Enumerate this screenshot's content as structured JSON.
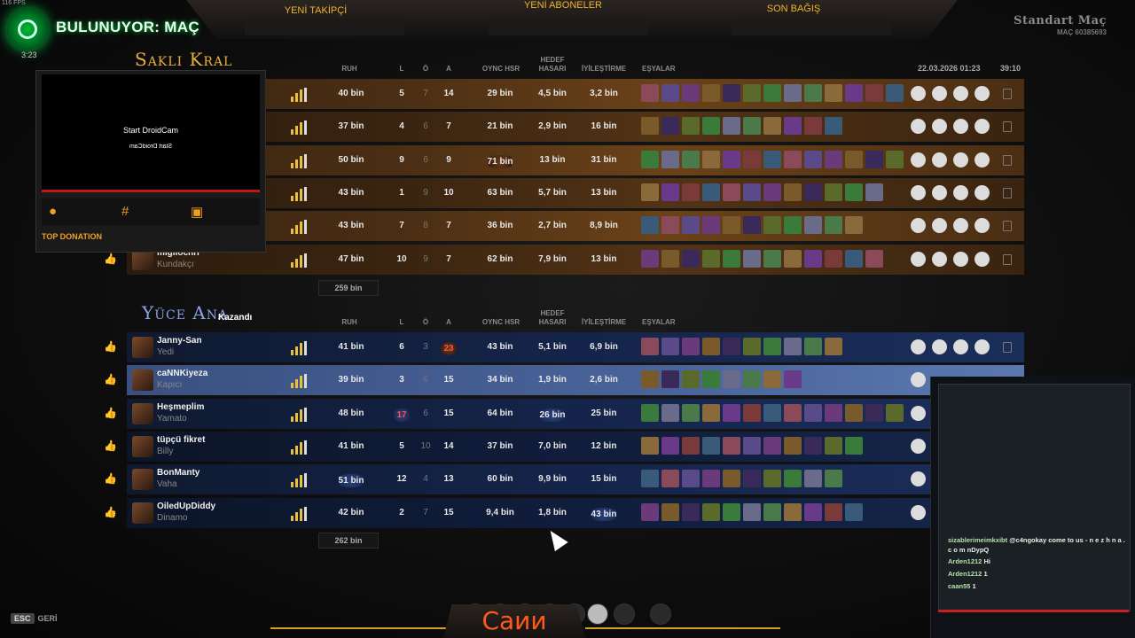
{
  "overlay": {
    "fps": "116 FPS",
    "status": "BULUNUYOR: MAÇ",
    "timer": "3:23",
    "new_follower": "YENİ TAKİPÇİ",
    "new_subscribers": "YENİ ABONELER",
    "last_donation": "SON BAĞIŞ",
    "mode": "Standart Maç",
    "match_id": "MAÇ 60385693",
    "webcam_text": "Start DroidCam",
    "top_donation": "TOP DONATION"
  },
  "headers": {
    "ruh": "RUH",
    "l": "L",
    "o": "Ö",
    "a": "A",
    "oync": "OYNC HSR",
    "hedef1": "HEDEF",
    "hedef2": "HASARI",
    "heal": "İYİLEŞTİRME",
    "items": "EŞYALAR",
    "date": "22.03.2026 01:23",
    "duration": "39:10"
  },
  "team1": {
    "name": "Saklı Kral",
    "total": "259 bin",
    "players": [
      {
        "name": "",
        "hero": "",
        "ruh": "40 bin",
        "l": "5",
        "o": "7",
        "a": "14",
        "dmg": "29 bin",
        "tower": "4,5 bin",
        "heal": "3,2 bin"
      },
      {
        "name": "",
        "hero": "",
        "ruh": "37 bin",
        "l": "4",
        "o": "6",
        "a": "7",
        "dmg": "21 bin",
        "tower": "2,9 bin",
        "heal": "16 bin"
      },
      {
        "name": "",
        "hero": "",
        "ruh": "50 bin",
        "l": "9",
        "o": "6",
        "a": "9",
        "dmg": "71 bin",
        "tower": "13 bin",
        "heal": "31 bin"
      },
      {
        "name": "",
        "hero": "",
        "ruh": "43 bin",
        "l": "1",
        "o": "9",
        "a": "10",
        "dmg": "63 bin",
        "tower": "5,7 bin",
        "heal": "13 bin"
      },
      {
        "name": "",
        "hero": "",
        "ruh": "43 bin",
        "l": "7",
        "o": "8",
        "a": "7",
        "dmg": "36 bin",
        "tower": "2,7 bin",
        "heal": "8,9 bin"
      },
      {
        "name": "migllochri",
        "hero": "Kundakçı",
        "ruh": "47 bin",
        "l": "10",
        "o": "9",
        "a": "7",
        "dmg": "62 bin",
        "tower": "7,9 bin",
        "heal": "13 bin"
      }
    ]
  },
  "team2": {
    "name": "Yüce Ana",
    "result": "Kazandı",
    "total": "262 bin",
    "players": [
      {
        "name": "Janny-San",
        "hero": "Yedi",
        "ruh": "41 bin",
        "l": "6",
        "o": "3",
        "a": "23",
        "dmg": "43 bin",
        "tower": "5,1 bin",
        "heal": "6,9 bin"
      },
      {
        "name": "caNNKiyeza",
        "hero": "Kapıcı",
        "ruh": "39 bin",
        "l": "3",
        "o": "6",
        "a": "15",
        "dmg": "34 bin",
        "tower": "1,9 bin",
        "heal": "2,6 bin"
      },
      {
        "name": "Heşmeplim",
        "hero": "Yamato",
        "ruh": "48 bin",
        "l": "17",
        "o": "6",
        "a": "15",
        "dmg": "64 bin",
        "tower": "26 bin",
        "heal": "25 bin"
      },
      {
        "name": "tüpçü fikret",
        "hero": "Billy",
        "ruh": "41 bin",
        "l": "5",
        "o": "10",
        "a": "14",
        "dmg": "37 bin",
        "tower": "7,0 bin",
        "heal": "12 bin"
      },
      {
        "name": "BonManty",
        "hero": "Vaha",
        "ruh": "51 bin",
        "l": "12",
        "o": "4",
        "a": "13",
        "dmg": "60 bin",
        "tower": "9,9 bin",
        "heal": "15 bin"
      },
      {
        "name": "OiledUpDiddy",
        "hero": "Dinamo",
        "ruh": "42 bin",
        "l": "2",
        "o": "7",
        "a": "15",
        "dmg": "9,4 bin",
        "tower": "1,8 bin",
        "heal": "43 bin"
      }
    ]
  },
  "chat": {
    "messages": [
      {
        "user": "sizablerimeimkxibt",
        "text": "@c4ngokay come to us - n e z h n a . c o m nDypQ"
      },
      {
        "user": "Arden1212",
        "text": "Hi"
      },
      {
        "user": "Arden1212",
        "text": "1"
      },
      {
        "user": "caan55",
        "text": "1"
      }
    ]
  },
  "footer": {
    "esc_key": "ESC",
    "back": "GERİ",
    "caption": "Саии"
  },
  "colors": {
    "accent": "#f0b428",
    "team1": "#d89030",
    "team2": "#3a5a9a",
    "caption": "#ff5a1a"
  }
}
